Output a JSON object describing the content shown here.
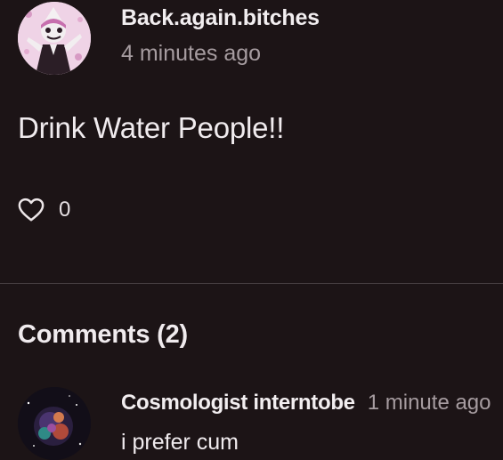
{
  "post": {
    "author": "Back.again.bitches",
    "time": "4 minutes ago",
    "body": "Drink Water People!!",
    "likes": "0"
  },
  "comments_section": {
    "title": "Comments (2)",
    "items": [
      {
        "author": "Cosmologist interntobe",
        "time": "1 minute ago",
        "text": "i prefer cum"
      }
    ]
  },
  "icons": {
    "like": "heart-outline-icon"
  },
  "colors": {
    "background": "#1c1416",
    "secondary_text": "#a69ca0",
    "divider": "#4a4245"
  }
}
